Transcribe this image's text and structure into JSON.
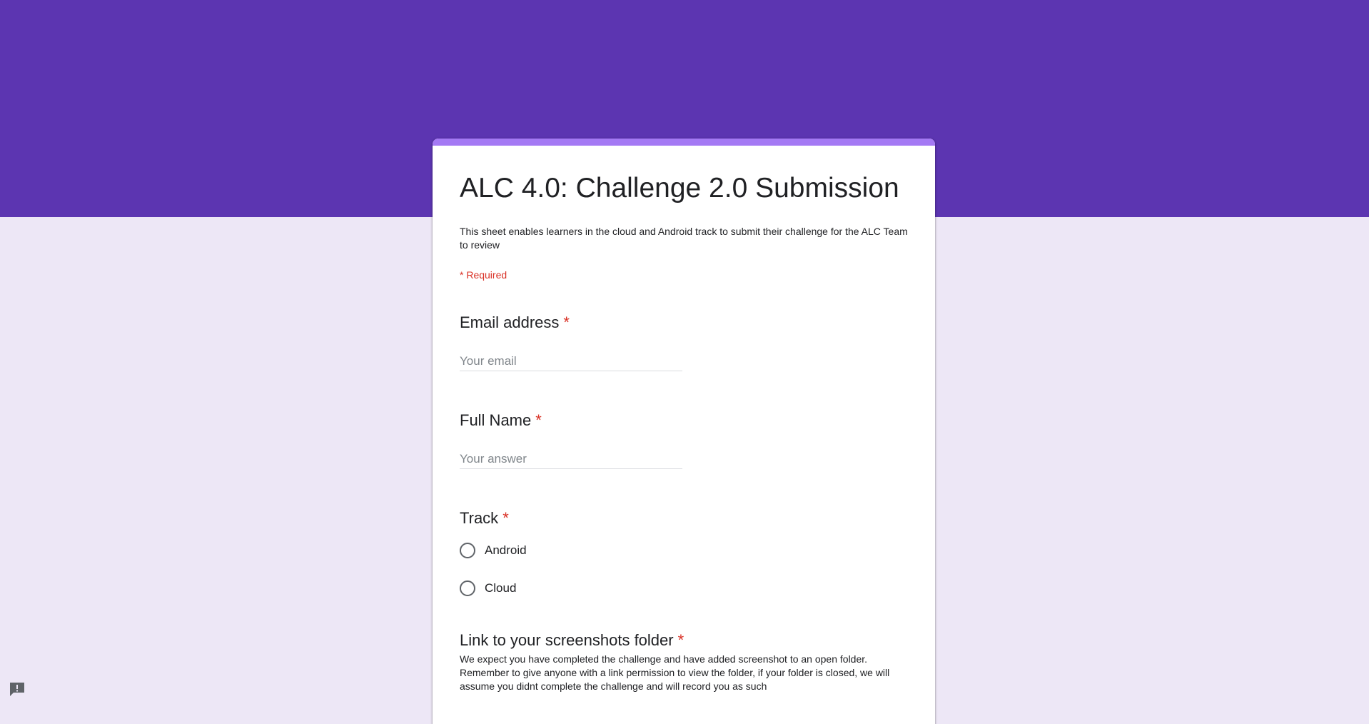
{
  "form": {
    "title": "ALC 4.0: Challenge 2.0 Submission",
    "description": "This sheet enables learners in the cloud and Android track to submit their challenge for the ALC Team to review",
    "required_note": "* Required",
    "questions": [
      {
        "label": "Email address",
        "required_mark": "*",
        "type": "text",
        "placeholder": "Your email",
        "value": ""
      },
      {
        "label": "Full Name",
        "required_mark": "*",
        "type": "text",
        "placeholder": "Your answer",
        "value": ""
      },
      {
        "label": "Track",
        "required_mark": "*",
        "type": "radio",
        "options": [
          "Android",
          "Cloud"
        ],
        "selected": null
      },
      {
        "label": "Link to your screenshots folder",
        "required_mark": "*",
        "type": "text",
        "description": "We expect you have completed the challenge and have added screenshot to an open folder. Remember to give anyone with a link permission to view the folder, if your folder is closed, we will assume you didnt complete the challenge and will record you as such"
      }
    ]
  },
  "colors": {
    "header_band": "#5c35b1",
    "card_accent": "#a479f4",
    "page_background": "#ede7f6",
    "required": "#d93025"
  },
  "icons": {
    "feedback": "report-problem-icon"
  }
}
